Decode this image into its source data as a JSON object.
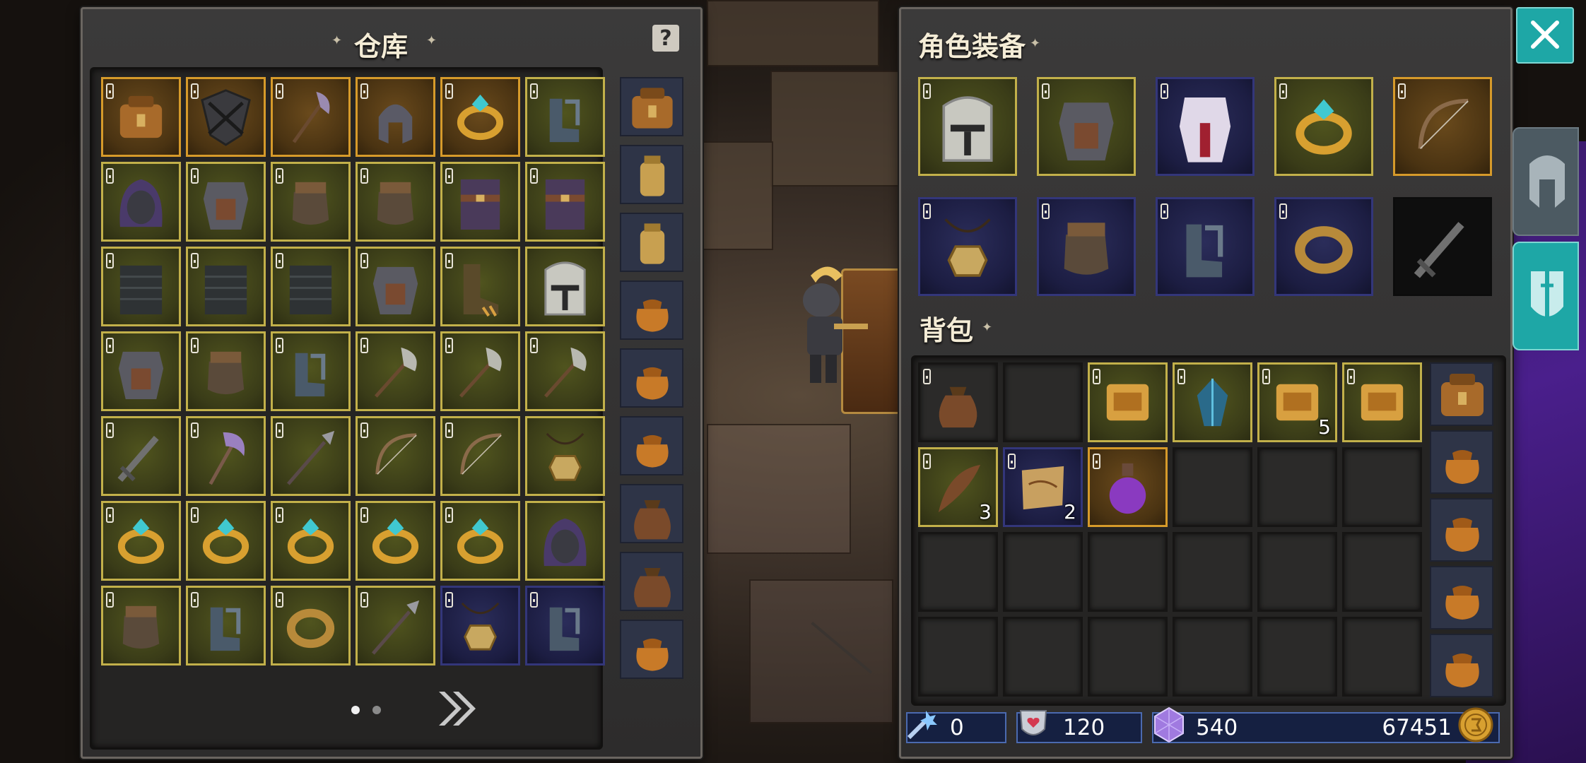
{
  "warehouse": {
    "title": "仓库",
    "help_icon": "?",
    "page_count": 2,
    "current_page": 1,
    "items": [
      {
        "icon": "satchel-icon",
        "rarity": "epic",
        "locked": true
      },
      {
        "icon": "shield-icon",
        "rarity": "epic",
        "locked": true
      },
      {
        "icon": "halberd-icon",
        "rarity": "epic",
        "locked": true
      },
      {
        "icon": "helmet-icon",
        "rarity": "epic",
        "locked": true
      },
      {
        "icon": "ring-icon",
        "rarity": "epic",
        "locked": true
      },
      {
        "icon": "boots-icon",
        "rarity": "rare",
        "locked": true
      },
      {
        "icon": "hood-icon",
        "rarity": "rare",
        "locked": true
      },
      {
        "icon": "chest-armor-icon",
        "rarity": "rare",
        "locked": true
      },
      {
        "icon": "gauntlets-icon",
        "rarity": "rare",
        "locked": true
      },
      {
        "icon": "gauntlets-icon",
        "rarity": "rare",
        "locked": true
      },
      {
        "icon": "belt-armor-icon",
        "rarity": "rare",
        "locked": true
      },
      {
        "icon": "belt-armor-icon",
        "rarity": "rare",
        "locked": true
      },
      {
        "icon": "chainmail-icon",
        "rarity": "rare",
        "locked": true
      },
      {
        "icon": "chainmail-icon",
        "rarity": "rare",
        "locked": true
      },
      {
        "icon": "chainmail-icon",
        "rarity": "rare",
        "locked": true
      },
      {
        "icon": "chest-armor-icon",
        "rarity": "rare",
        "locked": true
      },
      {
        "icon": "claw-boots-icon",
        "rarity": "rare",
        "locked": true
      },
      {
        "icon": "great-helm-icon",
        "rarity": "rare",
        "locked": false
      },
      {
        "icon": "chest-armor-icon",
        "rarity": "rare",
        "locked": true
      },
      {
        "icon": "gauntlets-icon",
        "rarity": "rare",
        "locked": true
      },
      {
        "icon": "boots-icon",
        "rarity": "rare",
        "locked": true
      },
      {
        "icon": "axe-icon",
        "rarity": "rare",
        "locked": true
      },
      {
        "icon": "axe-icon",
        "rarity": "rare",
        "locked": true
      },
      {
        "icon": "axe-icon",
        "rarity": "rare",
        "locked": true
      },
      {
        "icon": "sword-icon",
        "rarity": "rare",
        "locked": true
      },
      {
        "icon": "battle-axe-icon",
        "rarity": "rare",
        "locked": true
      },
      {
        "icon": "spear-icon",
        "rarity": "rare",
        "locked": true
      },
      {
        "icon": "bow-icon",
        "rarity": "rare",
        "locked": true
      },
      {
        "icon": "bow-icon",
        "rarity": "rare",
        "locked": true
      },
      {
        "icon": "amulet-icon",
        "rarity": "rare",
        "locked": false
      },
      {
        "icon": "ring-icon",
        "rarity": "rare",
        "locked": true
      },
      {
        "icon": "ring-icon",
        "rarity": "rare",
        "locked": true
      },
      {
        "icon": "ring-icon",
        "rarity": "rare",
        "locked": true
      },
      {
        "icon": "ring-icon",
        "rarity": "rare",
        "locked": true
      },
      {
        "icon": "ring-icon",
        "rarity": "rare",
        "locked": true
      },
      {
        "icon": "hood-icon",
        "rarity": "rare",
        "locked": false
      },
      {
        "icon": "gauntlets-icon",
        "rarity": "rare",
        "locked": true
      },
      {
        "icon": "boots-icon",
        "rarity": "rare",
        "locked": true
      },
      {
        "icon": "bracelet-icon",
        "rarity": "rare",
        "locked": true
      },
      {
        "icon": "spear-icon",
        "rarity": "rare",
        "locked": true
      },
      {
        "icon": "amulet-icon",
        "rarity": "magic",
        "locked": true
      },
      {
        "icon": "boots-icon",
        "rarity": "magic",
        "locked": true
      }
    ],
    "bag_tabs": [
      "satchel-icon",
      "small-backpack-icon",
      "small-backpack-icon",
      "pouch-icon",
      "pouch-icon",
      "pouch-icon",
      "sack-icon",
      "sack-icon",
      "pouch-icon"
    ]
  },
  "equipment": {
    "title": "角色装备",
    "slots": [
      {
        "icon": "great-helm-icon",
        "rarity": "rare",
        "locked": true
      },
      {
        "icon": "chest-armor-icon",
        "rarity": "rare",
        "locked": true
      },
      {
        "icon": "plate-armor-icon",
        "rarity": "magic",
        "locked": true
      },
      {
        "icon": "ring-icon",
        "rarity": "rare",
        "locked": true
      },
      {
        "icon": "bow-icon",
        "rarity": "epic",
        "locked": true
      },
      {
        "icon": "amulet-icon",
        "rarity": "magic",
        "locked": true
      },
      {
        "icon": "gauntlets-icon",
        "rarity": "magic",
        "locked": true
      },
      {
        "icon": "boots-icon",
        "rarity": "magic",
        "locked": true
      },
      {
        "icon": "bracelet-icon",
        "rarity": "magic",
        "locked": true
      },
      {
        "icon": "sword-icon",
        "rarity": "empty",
        "locked": false
      }
    ]
  },
  "backpack": {
    "title": "背包",
    "items": [
      {
        "icon": "sack-icon",
        "rarity": "empty",
        "locked": true,
        "qty": ""
      },
      {
        "icon": "",
        "rarity": "empty",
        "locked": false,
        "qty": ""
      },
      {
        "icon": "scroll-icon",
        "rarity": "rare",
        "locked": true,
        "qty": ""
      },
      {
        "icon": "crystal-icon",
        "rarity": "rare",
        "locked": true,
        "qty": ""
      },
      {
        "icon": "scroll-icon",
        "rarity": "rare",
        "locked": true,
        "qty": "5"
      },
      {
        "icon": "scroll-icon",
        "rarity": "rare",
        "locked": true,
        "qty": ""
      },
      {
        "icon": "feather-icon",
        "rarity": "rare",
        "locked": true,
        "qty": "3"
      },
      {
        "icon": "map-icon",
        "rarity": "magic",
        "locked": true,
        "qty": "2"
      },
      {
        "icon": "potion-icon",
        "rarity": "epic",
        "locked": true,
        "qty": ""
      }
    ],
    "bag_tabs": [
      "satchel-icon",
      "pouch-icon",
      "pouch-icon",
      "pouch-icon",
      "pouch-icon"
    ]
  },
  "status": {
    "skill_points": "0",
    "shards": "120",
    "gems": "540",
    "gold": "67451"
  },
  "colors": {
    "rare_border": "#c2b04a",
    "epic_border": "#d69a2a",
    "magic_border": "#33367a",
    "accent_teal": "#1ea7a6"
  }
}
